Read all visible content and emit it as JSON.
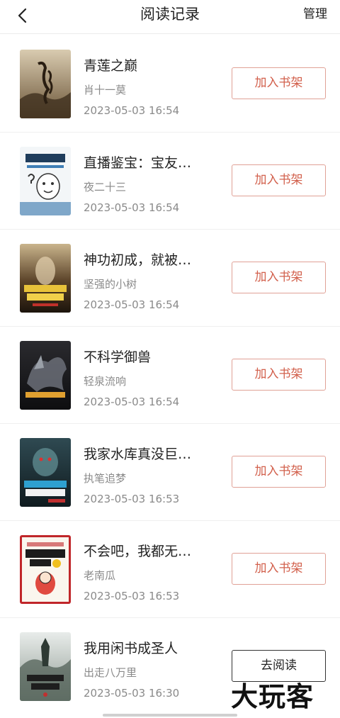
{
  "header": {
    "back_icon": "chevron-left-icon",
    "title": "阅读记录",
    "manage_label": "管理"
  },
  "books": [
    {
      "title": "青莲之巅",
      "author": "肖十一莫",
      "time": "2023-05-03 16:54",
      "action": "加入书架"
    },
    {
      "title": "直播鉴宝：宝友…",
      "author": "夜二十三",
      "time": "2023-05-03 16:54",
      "action": "加入书架"
    },
    {
      "title": "神功初成，就被…",
      "author": "坚强的小树",
      "time": "2023-05-03 16:54",
      "action": "加入书架"
    },
    {
      "title": "不科学御兽",
      "author": "轻泉流响",
      "time": "2023-05-03 16:54",
      "action": "加入书架"
    },
    {
      "title": "我家水库真没巨…",
      "author": "执笔追梦",
      "time": "2023-05-03 16:53",
      "action": "加入书架"
    },
    {
      "title": "不会吧，我都无…",
      "author": "老南瓜",
      "time": "2023-05-03 16:53",
      "action": "加入书架"
    },
    {
      "title": "我用闲书成圣人",
      "author": "出走八万里",
      "time": "2023-05-03 16:30",
      "action": "去阅读"
    }
  ],
  "colors": {
    "accent": "#d2604c",
    "text_primary": "#222222",
    "text_secondary": "#8a8a8a"
  },
  "watermark": "大玩客"
}
